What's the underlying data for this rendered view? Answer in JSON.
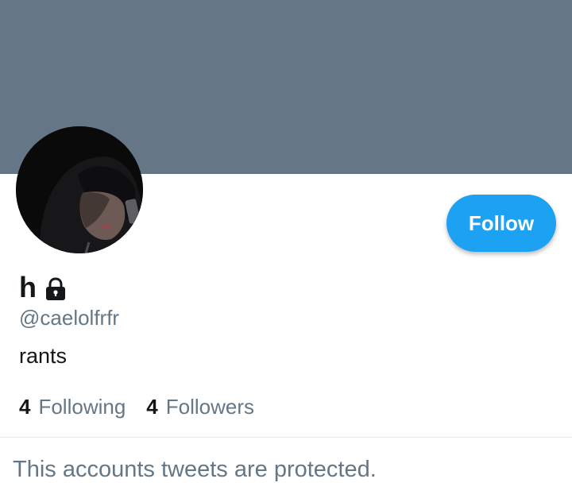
{
  "profile": {
    "display_name": "h",
    "handle": "@caelolfrfr",
    "bio": "rants",
    "protected_icon": "lock-icon",
    "avatar_icon": "profile-photo"
  },
  "actions": {
    "follow_label": "Follow"
  },
  "stats": {
    "following_count": "4",
    "following_label": "Following",
    "followers_count": "4",
    "followers_label": "Followers"
  },
  "timeline": {
    "protected_message": "This accounts tweets are protected."
  },
  "colors": {
    "banner": "#657786",
    "accent": "#1da1f2",
    "primary_text": "#14171a",
    "secondary_text": "#657786"
  }
}
